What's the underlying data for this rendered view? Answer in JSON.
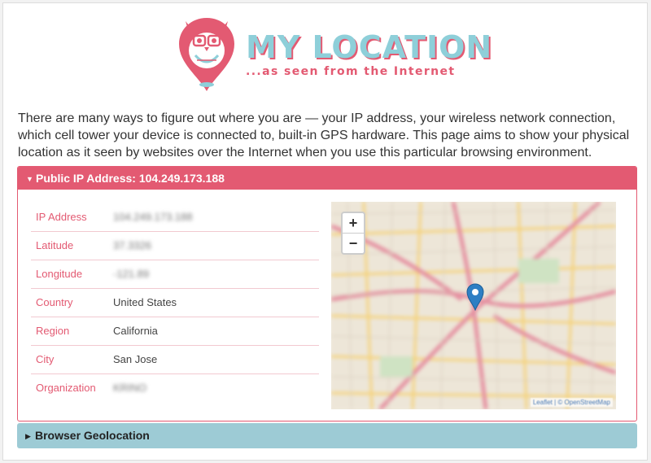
{
  "header": {
    "title": "MY LOCATION",
    "tagline": "...as seen from the Internet"
  },
  "intro": "There are many ways to figure out where you are — your IP address, your wireless network connection, which cell tower your device is connected to, built-in GPS hardware. This page aims to show your physical location as it seen by websites over the Internet when you use this particular browsing environment.",
  "public_ip": {
    "heading": "Public IP Address: 104.249.173.188",
    "rows": [
      {
        "label": "IP Address",
        "value": "104.249.173.188",
        "blurred": true
      },
      {
        "label": "Latitude",
        "value": "37.3326",
        "blurred": true
      },
      {
        "label": "Longitude",
        "value": "-121.89",
        "blurred": true
      },
      {
        "label": "Country",
        "value": "United States",
        "blurred": false
      },
      {
        "label": "Region",
        "value": "California",
        "blurred": false
      },
      {
        "label": "City",
        "value": "San Jose",
        "blurred": false
      },
      {
        "label": "Organization",
        "value": "KRINO",
        "blurred": true
      }
    ],
    "map": {
      "zoom_in": "+",
      "zoom_out": "−",
      "attribution": "Leaflet | © OpenStreetMap"
    }
  },
  "geolocation": {
    "heading": "Browser Geolocation"
  },
  "colors": {
    "accent": "#e35a72",
    "secondary": "#9dcbd5",
    "logo_teal": "#8ecfd9"
  }
}
